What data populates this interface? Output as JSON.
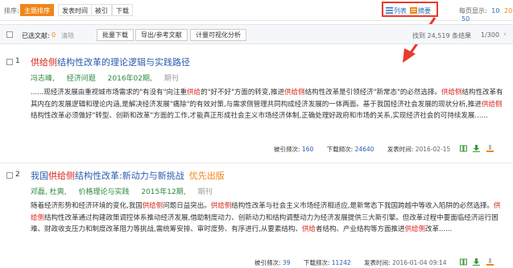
{
  "sortbar": {
    "label": "排序:",
    "sorts": [
      {
        "label": "主题排序",
        "active": true
      },
      {
        "label": "发表时间",
        "active": false
      },
      {
        "label": "被引",
        "active": false
      },
      {
        "label": "下载",
        "active": false
      }
    ],
    "view_list": "列表",
    "view_abstract": "摘要",
    "perpage_label": "每页显示:",
    "perpage_options": [
      "10",
      "20",
      "50"
    ],
    "perpage_current": "10"
  },
  "toolbar": {
    "selected_label": "已选文献:",
    "selected_count": "0",
    "clear_label": "清除",
    "batch_download": "批量下载",
    "export": "导出/参考文献",
    "visualize": "计量可视化分析",
    "total": "找到 24,519 条结果",
    "page": "1/300"
  },
  "results": [
    {
      "num": "1",
      "title_hl": "供给侧",
      "title_rest": "结构性改革的理论逻辑与实践路径",
      "first_pub": "",
      "authors": "冯志峰,",
      "journal": "经济问题",
      "issue": "2016年02期,",
      "source": "期刊",
      "abstract_parts": [
        {
          "t": "......现经济发展由重视城市场需求的\"有没有\"向注重",
          "h": false
        },
        {
          "t": "供给",
          "h": true
        },
        {
          "t": "的\"好不好\"方面的转变,推进",
          "h": false
        },
        {
          "t": "供给侧",
          "h": true
        },
        {
          "t": "结构性改革是引领经济\"新常态\"的必然选择。",
          "h": false
        },
        {
          "t": "供给侧",
          "h": true
        },
        {
          "t": "结构性改革有其内在的发展逻辑和理论内涵,是解决经济发展\"痛除\"的有效对策,与需求侧管理共同构成经济发展的一体两面。基于我国经济社会发展的现状分析,推进",
          "h": false
        },
        {
          "t": "供给侧",
          "h": true
        },
        {
          "t": "结构性改革必须做好\"转型、创新和改革\"方面的工作,才能真正形成社会主义市场经济体制,正确处理好政府和市场的关系,实现经济社会的可持续发展......",
          "h": false
        }
      ],
      "cited_label": "被引频次:",
      "cited": "160",
      "downloads_label": "下载频次:",
      "downloads": "24640",
      "date_label": "发表时间:",
      "date": "2016-02-15"
    },
    {
      "num": "2",
      "title_pre": "我国",
      "title_hl": "供给侧",
      "title_rest": "结构性改革:新动力与新挑战",
      "first_pub": "优先出版",
      "authors": "邓磊, 杜爽,",
      "journal": "价格理论与实践",
      "issue": "2015年12期,",
      "source": "期刊",
      "abstract_parts": [
        {
          "t": "随着经济形势和经济环境的变化,我国",
          "h": false
        },
        {
          "t": "供给侧",
          "h": true
        },
        {
          "t": "问题日益突出。",
          "h": false
        },
        {
          "t": "供给侧",
          "h": true
        },
        {
          "t": "结构性改革与社会主义市场经济相适应,是新常态下我国跨越中等收入陷阱的必然选择。",
          "h": false
        },
        {
          "t": "供给侧",
          "h": true
        },
        {
          "t": "结构性改革通过构建政策调控体系推动经济发展,借助制度动力、创新动力和结构调整动力为经济发展提供三大新引擎。但改革过程中要面临经济运行困难、财政收支压力和制度改革阻力等挑战,需统筹安排、审时度势、有序进行,从要素结构、",
          "h": false
        },
        {
          "t": "供给",
          "h": true
        },
        {
          "t": "者结构、产业结构等方面推进",
          "h": false
        },
        {
          "t": "供给侧",
          "h": true
        },
        {
          "t": "改革......",
          "h": false
        }
      ],
      "cited_label": "被引频次:",
      "cited": "39",
      "downloads_label": "下载频次:",
      "downloads": "11242",
      "date_label": "发表时间:",
      "date": "2016-01-04 09:14"
    }
  ],
  "colors": {
    "accent": "#f08519",
    "link": "#2a5db0",
    "highlight": "#d9261c",
    "annotation": "#e63b2e"
  }
}
